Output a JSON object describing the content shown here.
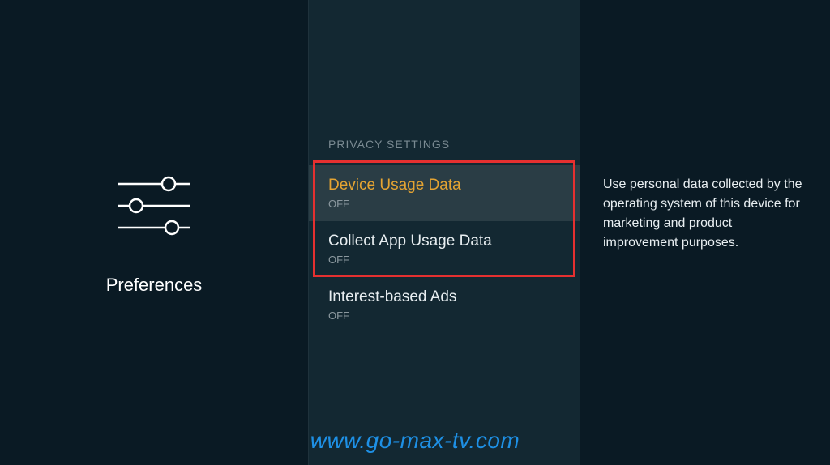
{
  "left": {
    "label": "Preferences"
  },
  "center": {
    "section_header": "PRIVACY SETTINGS",
    "items": [
      {
        "label": "Device Usage Data",
        "value": "OFF"
      },
      {
        "label": "Collect App Usage Data",
        "value": "OFF"
      },
      {
        "label": "Interest-based Ads",
        "value": "OFF"
      }
    ]
  },
  "right": {
    "description": "Use personal data collected by the operating system of this device for marketing and product improvement purposes."
  },
  "watermark": "www.go-max-tv.com"
}
